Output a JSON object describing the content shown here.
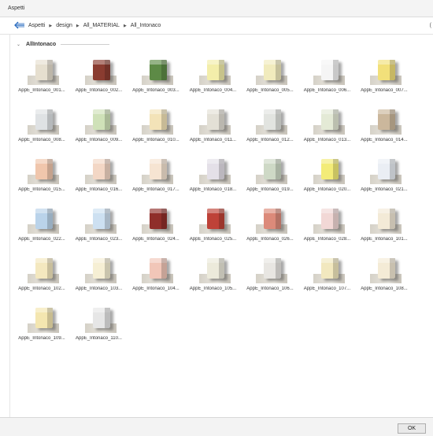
{
  "window": {
    "title": "Aspetti"
  },
  "nav": {
    "crumbs": [
      "Aspetti",
      "design",
      "All_MATERIAL",
      "All_Intonaco"
    ],
    "edge_mark": "("
  },
  "group": {
    "title": "AllIntonaco"
  },
  "materials": [
    {
      "label": "AppE_Intonaco_001...",
      "color": "#e6dfcf"
    },
    {
      "label": "AppE_Intonaco_002...",
      "color": "#8a3c30"
    },
    {
      "label": "AppE_Intonaco_003...",
      "color": "#5d8a46"
    },
    {
      "label": "AppE_Intonaco_004...",
      "color": "#f3eeaa"
    },
    {
      "label": "AppE_Intonaco_005...",
      "color": "#f1ebbd"
    },
    {
      "label": "AppE_Intonaco_006...",
      "color": "#f5f5f5"
    },
    {
      "label": "AppE_Intonaco_007...",
      "color": "#f2e07a"
    },
    {
      "label": "AppE_Intonaco_008...",
      "color": "#dfe2e4"
    },
    {
      "label": "AppE_Intonaco_009...",
      "color": "#cfe1b8"
    },
    {
      "label": "AppE_Intonaco_010...",
      "color": "#f3e3b8"
    },
    {
      "label": "AppE_Intonaco_011...",
      "color": "#e3e0d6"
    },
    {
      "label": "AppE_Intonaco_012...",
      "color": "#e2e4e0"
    },
    {
      "label": "AppE_Intonaco_013...",
      "color": "#e4ead6"
    },
    {
      "label": "AppE_Intonaco_014...",
      "color": "#cbb79c"
    },
    {
      "label": "AppE_Intonaco_015...",
      "color": "#f0c6ac"
    },
    {
      "label": "AppE_Intonaco_016...",
      "color": "#f3d7c5"
    },
    {
      "label": "AppE_Intonaco_017...",
      "color": "#f6e4d2"
    },
    {
      "label": "AppE_Intonaco_018...",
      "color": "#e4e0e8"
    },
    {
      "label": "AppE_Intonaco_019...",
      "color": "#ced9c6"
    },
    {
      "label": "AppE_Intonaco_020...",
      "color": "#f3ec78"
    },
    {
      "label": "AppE_Intonaco_021...",
      "color": "#eaeef4"
    },
    {
      "label": "AppE_Intonaco_022...",
      "color": "#bad3ea"
    },
    {
      "label": "AppE_Intonaco_023...",
      "color": "#cde0f1"
    },
    {
      "label": "AppE_Intonaco_024...",
      "color": "#8f2e2a"
    },
    {
      "label": "AppE_Intonaco_025...",
      "color": "#be4238"
    },
    {
      "label": "AppE_Intonaco_026...",
      "color": "#dc8a7a"
    },
    {
      "label": "AppE_Intonaco_028...",
      "color": "#f2d8d6"
    },
    {
      "label": "AppE_Intonaco_101...",
      "color": "#f3ead7"
    },
    {
      "label": "AppE_Intonaco_102...",
      "color": "#f4e8bf"
    },
    {
      "label": "AppE_Intonaco_103...",
      "color": "#f6efd4"
    },
    {
      "label": "AppE_Intonaco_104...",
      "color": "#f1c6b8"
    },
    {
      "label": "AppE_Intonaco_105...",
      "color": "#eceadb"
    },
    {
      "label": "AppE_Intonaco_106...",
      "color": "#e8e6e2"
    },
    {
      "label": "AppE_Intonaco_107...",
      "color": "#f2e8bf"
    },
    {
      "label": "AppE_Intonaco_108...",
      "color": "#f4ebd6"
    },
    {
      "label": "AppE_Intonaco_109...",
      "color": "#f4e6b0"
    },
    {
      "label": "AppE_Intonaco_110...",
      "color": "#e6e6e6"
    }
  ],
  "footer": {
    "ok_label": "OK"
  }
}
